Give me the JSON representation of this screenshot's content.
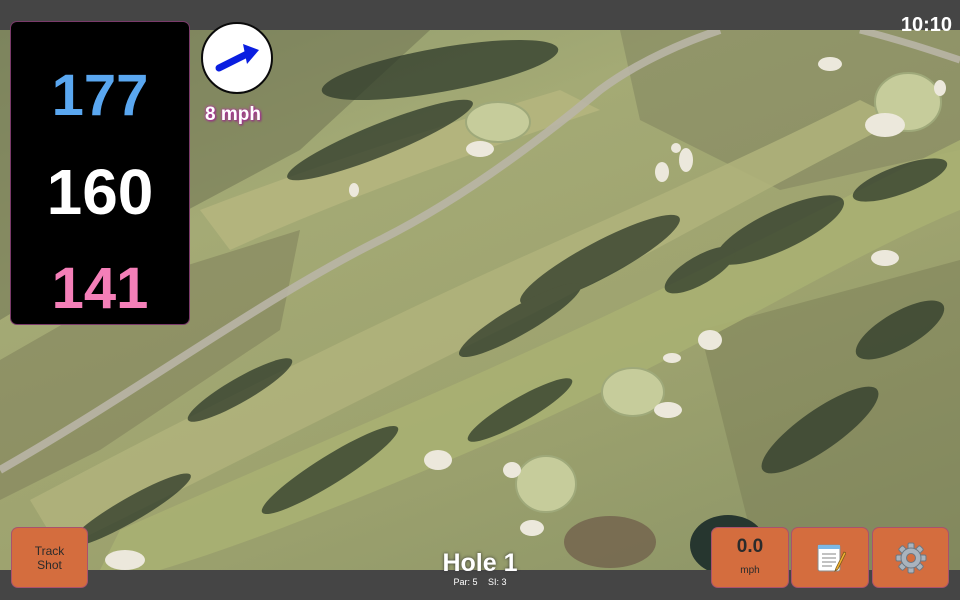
{
  "status": {
    "time": "10:10"
  },
  "distances": {
    "back": "177",
    "middle": "160",
    "front": "141"
  },
  "wind": {
    "speed_label": "8 mph",
    "icon": "wind-arrow-icon"
  },
  "hole": {
    "title": "Hole 1",
    "par": "Par: 5",
    "stroke_index": "SI: 3"
  },
  "buttons": {
    "track_shot": "Track\nShot",
    "speed_value": "0.0",
    "speed_unit": "mph",
    "notes_icon": "notepad-icon",
    "settings_icon": "gear-icon"
  },
  "colors": {
    "back_distance": "#5aa7f0",
    "middle_distance": "#ffffff",
    "front_distance": "#f47fb8",
    "button": "#d46d3e",
    "wind_arrow": "#0a1ee0"
  }
}
